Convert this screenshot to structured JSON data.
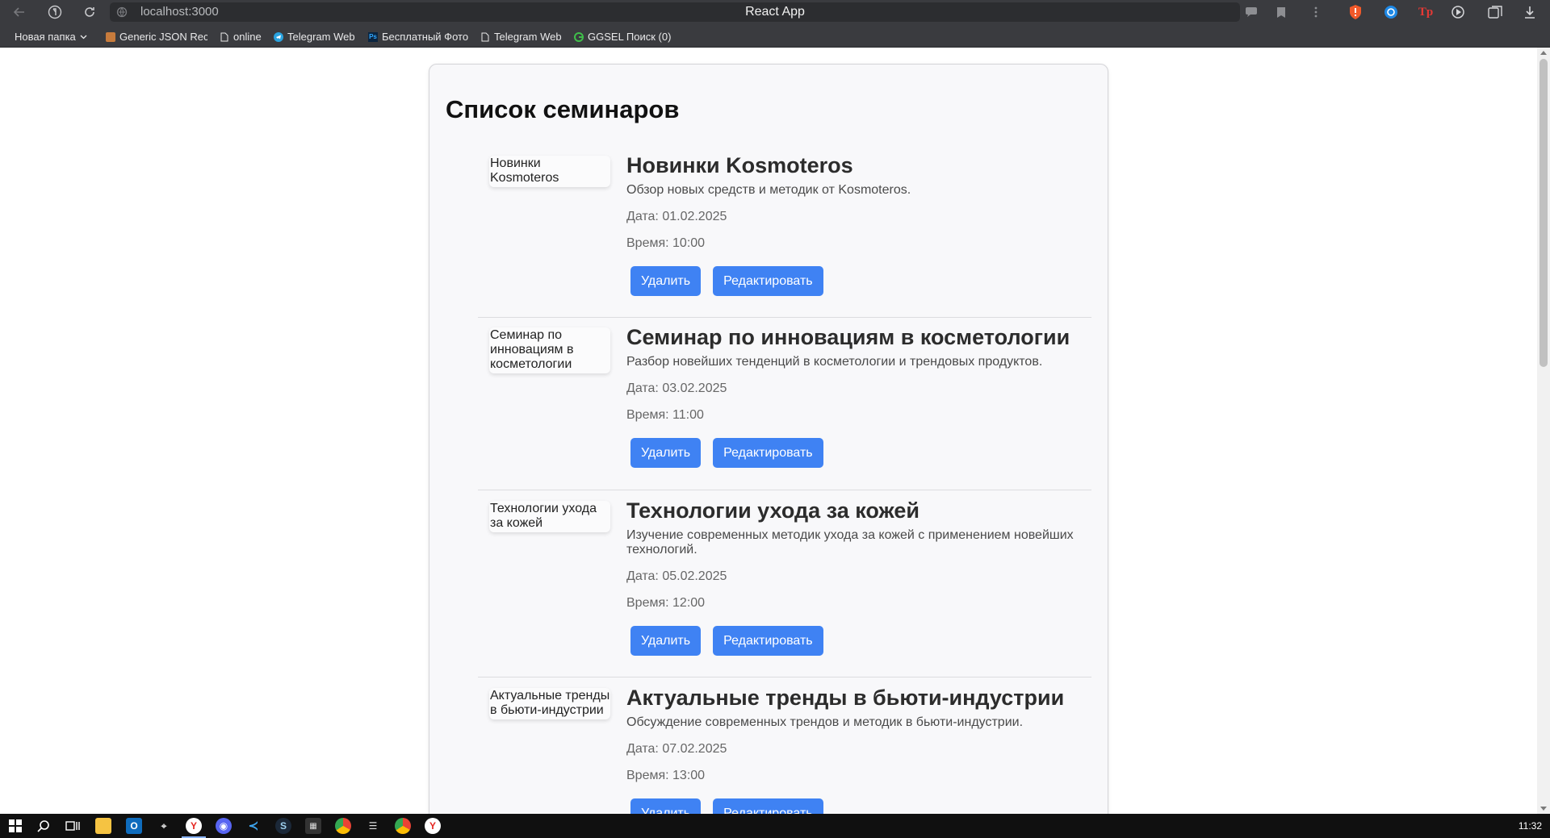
{
  "browser": {
    "url": "localhost:3000",
    "page_title": "React App",
    "bookmarks": [
      {
        "label": "Новая папка",
        "icon": "folder-chevron-icon"
      },
      {
        "label": "Generic JSON Rec",
        "icon": "json-icon"
      },
      {
        "label": "online",
        "icon": "page-icon"
      },
      {
        "label": "Telegram Web",
        "icon": "telegram-icon"
      },
      {
        "label": "Бесплатный Фото",
        "icon": "photoshop-icon"
      },
      {
        "label": "Telegram Web",
        "icon": "page-icon"
      },
      {
        "label": "GGSEL Поиск (0)",
        "icon": "ggsel-icon"
      }
    ],
    "extension_text": "Tp"
  },
  "page": {
    "heading": "Список семинаров",
    "delete_label": "Удалить",
    "edit_label": "Редактировать",
    "seminars": [
      {
        "image_alt": "Новинки Kosmoteros",
        "title": "Новинки Kosmoteros",
        "description": "Обзор новых средств и методик от Kosmoteros.",
        "date": "Дата: 01.02.2025",
        "time": "Время: 10:00"
      },
      {
        "image_alt": "Семинар по инновациям в косметологии",
        "title": "Семинар по инновациям в косметологии",
        "description": "Разбор новейших тенденций в косметологии и трендовых продуктов.",
        "date": "Дата: 03.02.2025",
        "time": "Время: 11:00"
      },
      {
        "image_alt": "Технологии ухода за кожей",
        "title": "Технологии ухода за кожей",
        "description": "Изучение современных методик ухода за кожей с применением новейших технологий.",
        "date": "Дата: 05.02.2025",
        "time": "Время: 12:00"
      },
      {
        "image_alt": "Актуальные тренды в бьюти-индустрии",
        "title": "Актуальные тренды в бьюти-индустрии",
        "description": "Обсуждение современных трендов и методик в бьюти-индустрии.",
        "date": "Дата: 07.02.2025",
        "time": "Время: 13:00"
      }
    ]
  },
  "taskbar": {
    "clock": "11:32"
  },
  "colors": {
    "accent_button": "#3f82f3",
    "chrome_bg": "#3a3b3f",
    "taskbar_bg": "#101010"
  }
}
